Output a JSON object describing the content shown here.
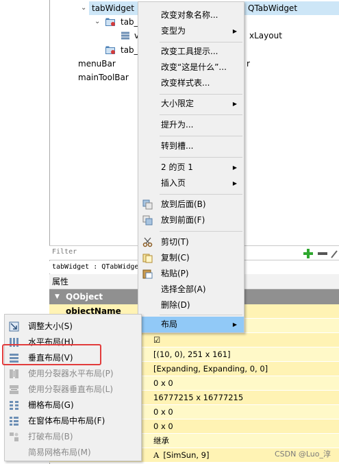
{
  "tree": {
    "items": [
      {
        "label": "tabWidget",
        "type": "QTabWidget"
      },
      {
        "label": "tab_",
        "type": ""
      },
      {
        "label": "v",
        "type": "xLayout"
      },
      {
        "label": "tab_",
        "type": ""
      },
      {
        "label": "menuBar",
        "type": "r"
      },
      {
        "label": "mainToolBar",
        "type": ""
      }
    ]
  },
  "filter": {
    "placeholder": "Filter"
  },
  "path_line": "tabWidget : QTabWidge",
  "props": {
    "header": "属性",
    "section": "QObject",
    "object_name_label": "objectName",
    "values": [
      "☑",
      "[(10, 0), 251 x 161]",
      "[Expanding, Expanding, 0, 0]",
      "0 x 0",
      "16777215 x 16777215",
      "0 x 0",
      "0 x 0",
      "继承",
      "[SimSun, 9]"
    ],
    "font_glyph": "A"
  },
  "menu": {
    "items": [
      "改变对象名称...",
      "变型为",
      "改变工具提示...",
      "改变“这是什么”...",
      "改变样式表...",
      "大小限定",
      "提升为...",
      "转到槽...",
      "2 的页 1",
      "插入页",
      "放到后面(B)",
      "放到前面(F)",
      "剪切(T)",
      "复制(C)",
      "粘贴(P)",
      "选择全部(A)",
      "删除(D)",
      "布局"
    ],
    "accent": "#91c9f7"
  },
  "submenu": {
    "items": [
      "调整大小(S)",
      "水平布局(H)",
      "垂直布局(V)",
      "使用分裂器水平布局(P)",
      "使用分裂器垂直布局(L)",
      "栅格布局(G)",
      "在窗体布局中布局(F)",
      "打破布局(B)",
      "简易网格布局(M)"
    ],
    "highlight_color": "#e23b3b"
  },
  "watermark": "CSDN @Luo_淳"
}
